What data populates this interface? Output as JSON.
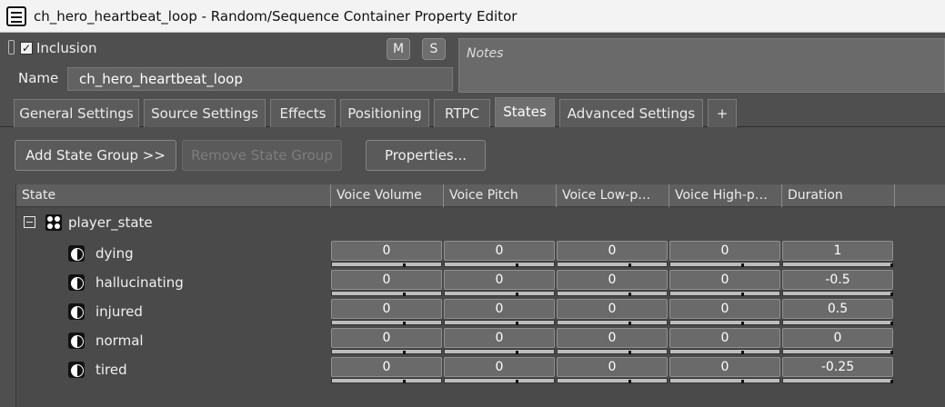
{
  "window": {
    "title": "ch_hero_heartbeat_loop - Random/Sequence Container Property Editor"
  },
  "header": {
    "inclusion_label": "Inclusion",
    "inclusion_checked": true,
    "mute_label": "M",
    "solo_label": "S",
    "name_label": "Name",
    "name_value": "ch_hero_heartbeat_loop",
    "notes_placeholder": "Notes"
  },
  "tabs": [
    {
      "label": "General Settings",
      "active": false
    },
    {
      "label": "Source Settings",
      "active": false
    },
    {
      "label": "Effects",
      "active": false
    },
    {
      "label": "Positioning",
      "active": false
    },
    {
      "label": "RTPC",
      "active": false
    },
    {
      "label": "States",
      "active": true
    },
    {
      "label": "Advanced Settings",
      "active": false
    },
    {
      "label": "+",
      "active": false
    }
  ],
  "toolbar": {
    "add_state_group": "Add State Group >>",
    "remove_state_group": "Remove State Group",
    "properties": "Properties..."
  },
  "grid": {
    "columns": [
      "State",
      "Voice Volume",
      "Voice Pitch",
      "Voice Low-p…",
      "Voice High-p…",
      "Duration"
    ],
    "group": {
      "name": "player_state",
      "expanded": true
    },
    "rows": [
      {
        "state": "dying",
        "values": [
          "0",
          "0",
          "0",
          "0",
          "1"
        ]
      },
      {
        "state": "hallucinating",
        "values": [
          "0",
          "0",
          "0",
          "0",
          "-0.5"
        ]
      },
      {
        "state": "injured",
        "values": [
          "0",
          "0",
          "0",
          "0",
          "0.5"
        ]
      },
      {
        "state": "normal",
        "values": [
          "0",
          "0",
          "0",
          "0",
          "0"
        ]
      },
      {
        "state": "tired",
        "values": [
          "0",
          "0",
          "0",
          "0",
          "-0.25"
        ]
      }
    ]
  },
  "colors": {
    "panel_bg": "#4f4f4f",
    "field_bg": "#626262",
    "title_bg": "#f3f3f3"
  }
}
